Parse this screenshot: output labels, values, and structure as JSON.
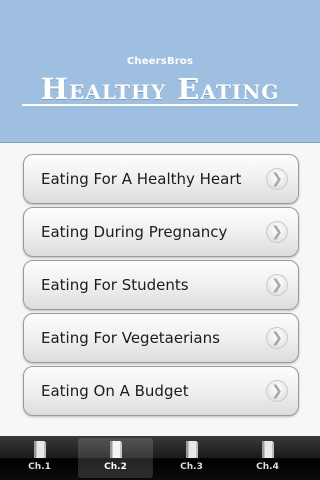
{
  "header": {
    "brand": "CheersBros",
    "title": "Healthy Eating"
  },
  "menu": {
    "items": [
      {
        "label": "Eating For A Healthy Heart"
      },
      {
        "label": "Eating During Pregnancy"
      },
      {
        "label": "Eating For Students"
      },
      {
        "label": "Eating For Vegetaerians"
      },
      {
        "label": "Eating On A Budget"
      }
    ],
    "chevron_glyph": "❯"
  },
  "tabbar": {
    "selected_index": 1,
    "tabs": [
      {
        "label": "Ch.1",
        "icon": "book-icon"
      },
      {
        "label": "Ch.2",
        "icon": "book-icon"
      },
      {
        "label": "Ch.3",
        "icon": "book-icon"
      },
      {
        "label": "Ch.4",
        "icon": "book-icon"
      }
    ]
  },
  "colors": {
    "header_bg": "#9fbfe0",
    "tabbar_bg": "#1a1a1a"
  }
}
